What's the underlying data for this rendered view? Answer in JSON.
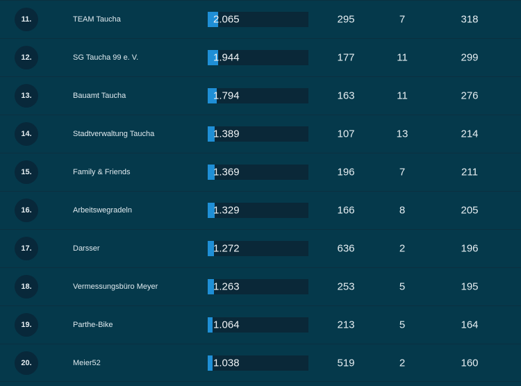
{
  "leaderboard": {
    "rows": [
      {
        "rank": "11.",
        "team": "TEAM Taucha",
        "value": "2.065",
        "share": 0.1,
        "col1": "295",
        "col2": "7",
        "col3": "318"
      },
      {
        "rank": "12.",
        "team": "SG Taucha 99 e. V.",
        "value": "1.944",
        "share": 0.1,
        "col1": "177",
        "col2": "11",
        "col3": "299"
      },
      {
        "rank": "13.",
        "team": "Bauamt Taucha",
        "value": "1.794",
        "share": 0.09,
        "col1": "163",
        "col2": "11",
        "col3": "276"
      },
      {
        "rank": "14.",
        "team": "Stadtverwaltung Taucha",
        "value": "1.389",
        "share": 0.07,
        "col1": "107",
        "col2": "13",
        "col3": "214"
      },
      {
        "rank": "15.",
        "team": "Family & Friends",
        "value": "1.369",
        "share": 0.07,
        "col1": "196",
        "col2": "7",
        "col3": "211"
      },
      {
        "rank": "16.",
        "team": "Arbeitswegradeln",
        "value": "1.329",
        "share": 0.07,
        "col1": "166",
        "col2": "8",
        "col3": "205"
      },
      {
        "rank": "17.",
        "team": "Darsser",
        "value": "1.272",
        "share": 0.06,
        "col1": "636",
        "col2": "2",
        "col3": "196"
      },
      {
        "rank": "18.",
        "team": "Vermessungsbüro Meyer",
        "value": "1.263",
        "share": 0.06,
        "col1": "253",
        "col2": "5",
        "col3": "195"
      },
      {
        "rank": "19.",
        "team": "Parthe-Bike",
        "value": "1.064",
        "share": 0.05,
        "col1": "213",
        "col2": "5",
        "col3": "164"
      },
      {
        "rank": "20.",
        "team": "Meier52",
        "value": "1.038",
        "share": 0.05,
        "col1": "519",
        "col2": "2",
        "col3": "160"
      }
    ]
  },
  "colors": {
    "background": "#05394b",
    "bar_fill": "#1f8fd6",
    "bar_track": "#0a2838",
    "rank_badge": "#08283a"
  }
}
